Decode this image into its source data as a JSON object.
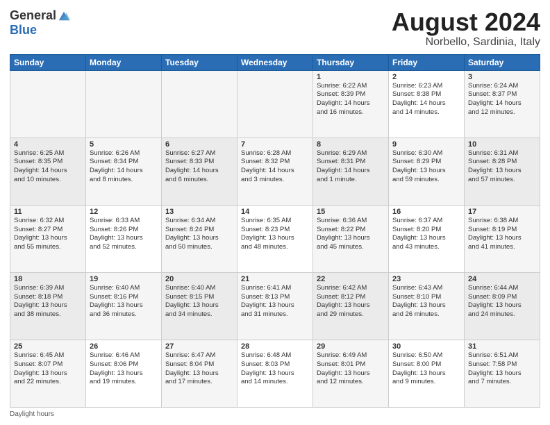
{
  "header": {
    "logo_general": "General",
    "logo_blue": "Blue",
    "month_title": "August 2024",
    "location": "Norbello, Sardinia, Italy"
  },
  "footer": {
    "note": "Daylight hours"
  },
  "days_of_week": [
    "Sunday",
    "Monday",
    "Tuesday",
    "Wednesday",
    "Thursday",
    "Friday",
    "Saturday"
  ],
  "weeks": [
    [
      {
        "num": "",
        "info": ""
      },
      {
        "num": "",
        "info": ""
      },
      {
        "num": "",
        "info": ""
      },
      {
        "num": "",
        "info": ""
      },
      {
        "num": "1",
        "info": "Sunrise: 6:22 AM\nSunset: 8:39 PM\nDaylight: 14 hours\nand 16 minutes."
      },
      {
        "num": "2",
        "info": "Sunrise: 6:23 AM\nSunset: 8:38 PM\nDaylight: 14 hours\nand 14 minutes."
      },
      {
        "num": "3",
        "info": "Sunrise: 6:24 AM\nSunset: 8:37 PM\nDaylight: 14 hours\nand 12 minutes."
      }
    ],
    [
      {
        "num": "4",
        "info": "Sunrise: 6:25 AM\nSunset: 8:35 PM\nDaylight: 14 hours\nand 10 minutes."
      },
      {
        "num": "5",
        "info": "Sunrise: 6:26 AM\nSunset: 8:34 PM\nDaylight: 14 hours\nand 8 minutes."
      },
      {
        "num": "6",
        "info": "Sunrise: 6:27 AM\nSunset: 8:33 PM\nDaylight: 14 hours\nand 6 minutes."
      },
      {
        "num": "7",
        "info": "Sunrise: 6:28 AM\nSunset: 8:32 PM\nDaylight: 14 hours\nand 3 minutes."
      },
      {
        "num": "8",
        "info": "Sunrise: 6:29 AM\nSunset: 8:31 PM\nDaylight: 14 hours\nand 1 minute."
      },
      {
        "num": "9",
        "info": "Sunrise: 6:30 AM\nSunset: 8:29 PM\nDaylight: 13 hours\nand 59 minutes."
      },
      {
        "num": "10",
        "info": "Sunrise: 6:31 AM\nSunset: 8:28 PM\nDaylight: 13 hours\nand 57 minutes."
      }
    ],
    [
      {
        "num": "11",
        "info": "Sunrise: 6:32 AM\nSunset: 8:27 PM\nDaylight: 13 hours\nand 55 minutes."
      },
      {
        "num": "12",
        "info": "Sunrise: 6:33 AM\nSunset: 8:26 PM\nDaylight: 13 hours\nand 52 minutes."
      },
      {
        "num": "13",
        "info": "Sunrise: 6:34 AM\nSunset: 8:24 PM\nDaylight: 13 hours\nand 50 minutes."
      },
      {
        "num": "14",
        "info": "Sunrise: 6:35 AM\nSunset: 8:23 PM\nDaylight: 13 hours\nand 48 minutes."
      },
      {
        "num": "15",
        "info": "Sunrise: 6:36 AM\nSunset: 8:22 PM\nDaylight: 13 hours\nand 45 minutes."
      },
      {
        "num": "16",
        "info": "Sunrise: 6:37 AM\nSunset: 8:20 PM\nDaylight: 13 hours\nand 43 minutes."
      },
      {
        "num": "17",
        "info": "Sunrise: 6:38 AM\nSunset: 8:19 PM\nDaylight: 13 hours\nand 41 minutes."
      }
    ],
    [
      {
        "num": "18",
        "info": "Sunrise: 6:39 AM\nSunset: 8:18 PM\nDaylight: 13 hours\nand 38 minutes."
      },
      {
        "num": "19",
        "info": "Sunrise: 6:40 AM\nSunset: 8:16 PM\nDaylight: 13 hours\nand 36 minutes."
      },
      {
        "num": "20",
        "info": "Sunrise: 6:40 AM\nSunset: 8:15 PM\nDaylight: 13 hours\nand 34 minutes."
      },
      {
        "num": "21",
        "info": "Sunrise: 6:41 AM\nSunset: 8:13 PM\nDaylight: 13 hours\nand 31 minutes."
      },
      {
        "num": "22",
        "info": "Sunrise: 6:42 AM\nSunset: 8:12 PM\nDaylight: 13 hours\nand 29 minutes."
      },
      {
        "num": "23",
        "info": "Sunrise: 6:43 AM\nSunset: 8:10 PM\nDaylight: 13 hours\nand 26 minutes."
      },
      {
        "num": "24",
        "info": "Sunrise: 6:44 AM\nSunset: 8:09 PM\nDaylight: 13 hours\nand 24 minutes."
      }
    ],
    [
      {
        "num": "25",
        "info": "Sunrise: 6:45 AM\nSunset: 8:07 PM\nDaylight: 13 hours\nand 22 minutes."
      },
      {
        "num": "26",
        "info": "Sunrise: 6:46 AM\nSunset: 8:06 PM\nDaylight: 13 hours\nand 19 minutes."
      },
      {
        "num": "27",
        "info": "Sunrise: 6:47 AM\nSunset: 8:04 PM\nDaylight: 13 hours\nand 17 minutes."
      },
      {
        "num": "28",
        "info": "Sunrise: 6:48 AM\nSunset: 8:03 PM\nDaylight: 13 hours\nand 14 minutes."
      },
      {
        "num": "29",
        "info": "Sunrise: 6:49 AM\nSunset: 8:01 PM\nDaylight: 13 hours\nand 12 minutes."
      },
      {
        "num": "30",
        "info": "Sunrise: 6:50 AM\nSunset: 8:00 PM\nDaylight: 13 hours\nand 9 minutes."
      },
      {
        "num": "31",
        "info": "Sunrise: 6:51 AM\nSunset: 7:58 PM\nDaylight: 13 hours\nand 7 minutes."
      }
    ]
  ]
}
